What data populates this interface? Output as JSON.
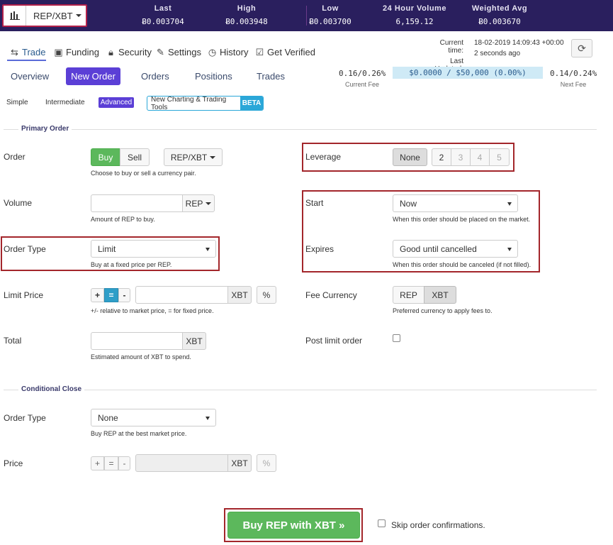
{
  "topbar": {
    "pair": "REP/XBT",
    "stats": [
      {
        "label": "Last",
        "value": "Ƀ0.003704"
      },
      {
        "label": "High",
        "value": "Ƀ0.003948"
      },
      {
        "label": "Low",
        "value": "Ƀ0.003700"
      },
      {
        "label": "24 Hour Volume",
        "value": "6,159.12"
      },
      {
        "label": "Weighted Avg",
        "value": "Ƀ0.003670"
      }
    ]
  },
  "nav": {
    "items": [
      "Trade",
      "Funding",
      "Security",
      "Settings",
      "History",
      "Get Verified"
    ],
    "current_time_label": "Current time:",
    "current_time": "18-02-2019 14:09:43 +00:00",
    "last_updated_label": "Last Updated:",
    "last_updated": "2 seconds ago"
  },
  "subtabs": [
    "Overview",
    "New Order",
    "Orders",
    "Positions",
    "Trades"
  ],
  "fees": {
    "current": "0.16/0.26%",
    "current_label": "Current Fee",
    "volume": "$0.0000 / $50,000 (0.00%)",
    "next": "0.14/0.24%",
    "next_label": "Next Fee"
  },
  "modes": [
    "Simple",
    "Intermediate",
    "Advanced"
  ],
  "charting": {
    "label": "New Charting & Trading Tools",
    "badge": "BETA"
  },
  "primary": {
    "section": "Primary Order",
    "order_label": "Order",
    "buy": "Buy",
    "sell": "Sell",
    "pair": "REP/XBT",
    "order_help": "Choose to buy or sell a currency pair.",
    "volume_label": "Volume",
    "volume_unit": "REP",
    "volume_help": "Amount of REP to buy.",
    "order_type_label": "Order Type",
    "order_type": "Limit",
    "order_type_help": "Buy at a fixed price per REP.",
    "limit_price_label": "Limit Price",
    "plus": "+",
    "equals": "=",
    "minus": "-",
    "price_unit": "XBT",
    "percent": "%",
    "limit_help": "+/- relative to market price, = for fixed price.",
    "total_label": "Total",
    "total_unit": "XBT",
    "total_help": "Estimated amount of XBT to spend.",
    "leverage_label": "Leverage",
    "leverage_options": [
      "None",
      "2",
      "3",
      "4",
      "5"
    ],
    "start_label": "Start",
    "start": "Now",
    "start_help": "When this order should be placed on the market.",
    "expires_label": "Expires",
    "expires": "Good until cancelled",
    "expires_help": "When this order should be canceled (if not filled).",
    "fee_currency_label": "Fee Currency",
    "fee_rep": "REP",
    "fee_xbt": "XBT",
    "fee_currency_help": "Preferred currency to apply fees to.",
    "post_limit_label": "Post limit order"
  },
  "conditional": {
    "section": "Conditional Close",
    "order_type_label": "Order Type",
    "order_type": "None",
    "order_type_help": "Buy REP at the best market price.",
    "price_label": "Price",
    "plus": "+",
    "equals": "=",
    "minus": "-",
    "price_unit": "XBT",
    "percent": "%"
  },
  "submit": {
    "label": "Buy REP with XBT »",
    "skip_label": "Skip order confirmations."
  }
}
